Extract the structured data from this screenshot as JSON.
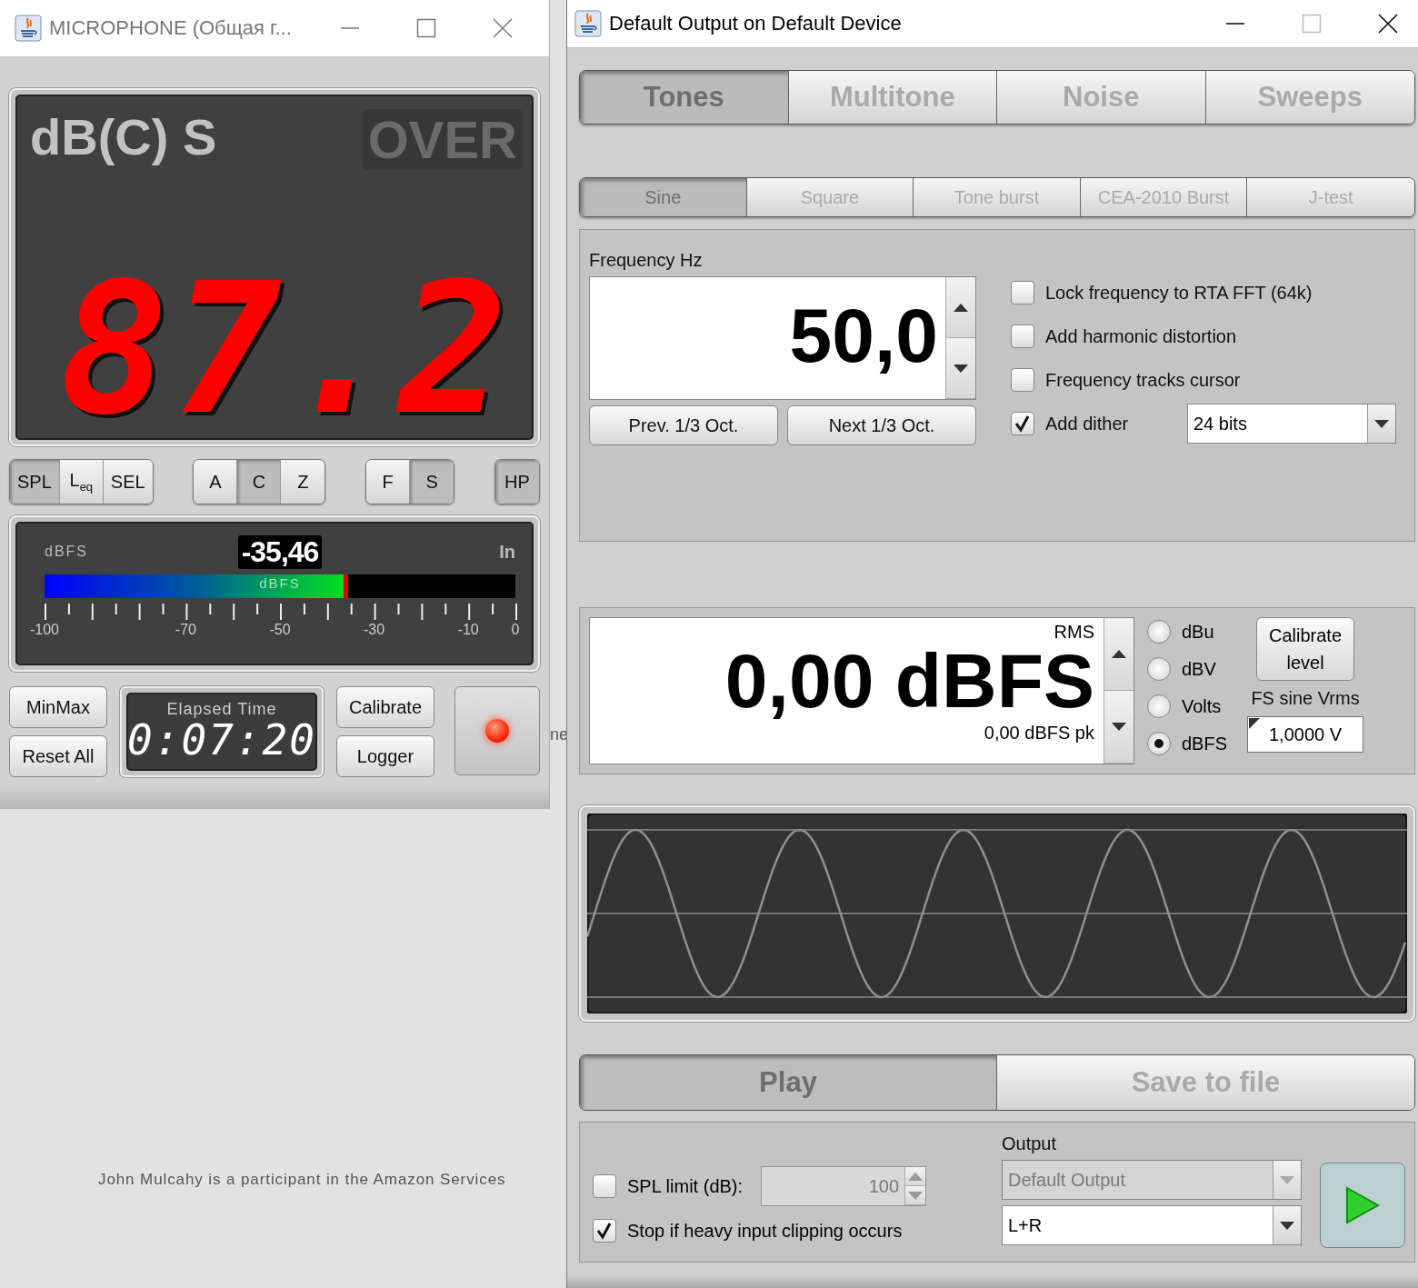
{
  "mic_window": {
    "title": "MICROPHONE (Общая г...",
    "display": {
      "mode": "dB(C) S",
      "over": "OVER",
      "over_lit": false,
      "reading": "87.2"
    },
    "mode_groups": [
      [
        {
          "label": "SPL",
          "selected": true
        },
        {
          "label": "L$_{eq}$",
          "selected": false
        },
        {
          "label": "SEL",
          "selected": false
        }
      ],
      [
        {
          "label": "A",
          "selected": false
        },
        {
          "label": "C",
          "selected": true
        },
        {
          "label": "Z",
          "selected": false
        }
      ],
      [
        {
          "label": "F",
          "selected": false
        },
        {
          "label": "S",
          "selected": true
        }
      ],
      [
        {
          "label": "HP",
          "selected": true
        }
      ]
    ],
    "meter": {
      "unit": "dBFS",
      "value": "-35,46",
      "channel": "In",
      "bar_label": "dBFS",
      "level": 0.645,
      "scale": [
        "-100",
        "-70",
        "-50",
        "-30",
        "-10",
        "0"
      ]
    },
    "left_buttons": [
      "MinMax",
      "Reset All"
    ],
    "elapsed": {
      "label": "Elapsed Time",
      "time": "0:07:20"
    },
    "right_buttons": [
      "Calibrate",
      "Logger"
    ],
    "indicator": {
      "on": true
    }
  },
  "desktop": {
    "fragment": "ne",
    "notice": "John Mulcahy is a participant in the Amazon Services"
  },
  "generator_window": {
    "title": "Default Output on Default Device",
    "tabs": [
      {
        "label": "Tones",
        "selected": true
      },
      {
        "label": "Multitone",
        "selected": false
      },
      {
        "label": "Noise",
        "selected": false
      },
      {
        "label": "Sweeps",
        "selected": false
      }
    ],
    "subtabs": [
      {
        "label": "Sine",
        "selected": true
      },
      {
        "label": "Square",
        "selected": false
      },
      {
        "label": "Tone burst",
        "selected": false
      },
      {
        "label": "CEA-2010 Burst",
        "selected": false
      },
      {
        "label": "J-test",
        "selected": false
      }
    ],
    "frequency": {
      "label": "Frequency Hz",
      "value": "50,0",
      "prev": "Prev. 1/3 Oct.",
      "next": "Next 1/3 Oct."
    },
    "options": [
      {
        "label": "Lock frequency to RTA FFT (64k)",
        "checked": false
      },
      {
        "label": "Add harmonic distortion",
        "checked": false
      },
      {
        "label": "Frequency tracks cursor",
        "checked": false
      },
      {
        "label": "Add dither",
        "checked": true
      }
    ],
    "dither": {
      "value": "24 bits"
    },
    "level": {
      "rms_label": "RMS",
      "value": "0,00 dBFS",
      "peak": "0,00 dBFS pk"
    },
    "units": [
      {
        "label": "dBu",
        "selected": false
      },
      {
        "label": "dBV",
        "selected": false
      },
      {
        "label": "Volts",
        "selected": false
      },
      {
        "label": "dBFS",
        "selected": true
      }
    ],
    "calibrate": "Calibrate level",
    "fs_label": "FS sine Vrms",
    "fs_value": "1,0000 V",
    "actions": [
      {
        "label": "Play",
        "selected": true
      },
      {
        "label": "Save to file",
        "selected": false
      }
    ],
    "spl_limit": {
      "label": "SPL limit (dB):",
      "checked": false,
      "value": "100",
      "disabled": true
    },
    "stop_clipping": {
      "label": "Stop if heavy input clipping occurs",
      "checked": true
    },
    "output_label": "Output",
    "output_device": {
      "value": "Default Output",
      "disabled": true
    },
    "output_channel": {
      "value": "L+R",
      "disabled": false
    }
  }
}
